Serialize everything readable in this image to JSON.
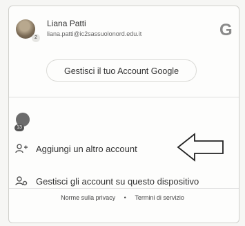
{
  "account": {
    "name": "Liana Patti",
    "email": "liana.patti@ic2sassuolonord.edu.it",
    "avatar_badge": "2",
    "manage_label": "Gestisci il tuo Account Google",
    "google_logo": "G"
  },
  "other_account": {
    "badge": "13"
  },
  "menu": [
    {
      "label": "Aggiungi un altro account",
      "icon": "add-person-icon"
    },
    {
      "label": "Gestisci gli account su questo dispositivo",
      "icon": "manage-accounts-icon"
    }
  ],
  "footer": {
    "privacy": "Norme sulla privacy",
    "separator": "•",
    "terms": "Termini di servizio"
  }
}
